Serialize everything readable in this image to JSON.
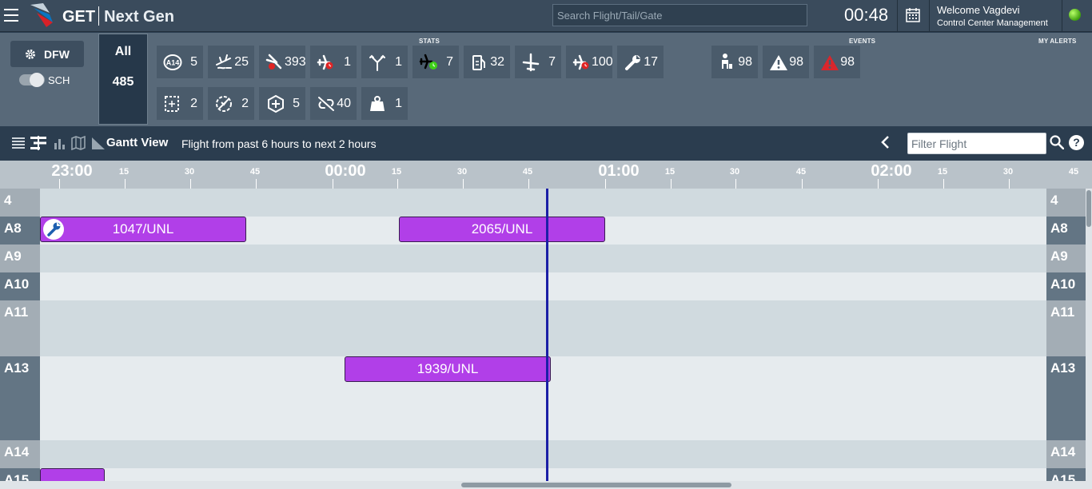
{
  "app": {
    "brand_primary": "GET",
    "brand_secondary": "Next Gen",
    "search_placeholder": "Search Flight/Tail/Gate",
    "clock": "00:48",
    "welcome": "Welcome Vagdevi",
    "role": "Control Center Management",
    "status_color": "#6bd11b"
  },
  "stats_panel": {
    "station": "DFW",
    "station_icon": "gear-icon",
    "toggle_label": "SCH",
    "all_label": "All",
    "all_count": "485",
    "section_stats": "STATS",
    "section_events": "EVENTS",
    "section_alerts": "MY ALERTS",
    "stats_row1": [
      {
        "icon": "a14-gate-badge-icon",
        "badge": "A14",
        "value": "5"
      },
      {
        "icon": "departure-route-icon",
        "value": "25"
      },
      {
        "icon": "delayed-arrival-icon",
        "value": "393"
      },
      {
        "icon": "late-departure-icon",
        "value": "1"
      },
      {
        "icon": "diversion-icon",
        "value": "1"
      },
      {
        "icon": "on-time-flight-icon",
        "value": "7"
      },
      {
        "icon": "fuel-icon",
        "value": "32"
      },
      {
        "icon": "aircraft-icon",
        "value": "7"
      },
      {
        "icon": "flight-delay-icon",
        "value": "100"
      },
      {
        "icon": "wrench-icon",
        "value": "17"
      }
    ],
    "stats_row2": [
      {
        "icon": "gate-hold-icon",
        "value": "2"
      },
      {
        "icon": "no-crew-icon",
        "value": "2"
      },
      {
        "icon": "inspection-icon",
        "value": "5"
      },
      {
        "icon": "broken-link-icon",
        "value": "40"
      },
      {
        "icon": "baggage-weight-icon",
        "value": "1"
      }
    ],
    "events": [
      {
        "icon": "passenger-icon",
        "value": "98"
      },
      {
        "icon": "warning-icon",
        "value": "98"
      },
      {
        "icon": "alert-red-icon",
        "value": "98"
      }
    ]
  },
  "toolbar": {
    "view_label": "Gantt View",
    "range_text": "Flight from past 6 hours to next 2 hours",
    "filter_placeholder": "Filter Flight",
    "help_label": "?"
  },
  "timeline": {
    "major": [
      "23:00",
      "00:00",
      "01:00",
      "02:00"
    ],
    "minor": [
      "15",
      "30",
      "45"
    ]
  },
  "gantt": {
    "rows": [
      {
        "gate": "4"
      },
      {
        "gate": "A8"
      },
      {
        "gate": "A9"
      },
      {
        "gate": "A10"
      },
      {
        "gate": "A11"
      },
      {
        "gate": "A13"
      },
      {
        "gate": "A14"
      },
      {
        "gate": "A15"
      }
    ],
    "flights": [
      {
        "label": "1047/UNL",
        "gate": "A8",
        "start": "22:54",
        "end": "23:39"
      },
      {
        "label": "2065/UNL",
        "gate": "A8",
        "start": "00:12",
        "end": "00:57"
      },
      {
        "label": "1939/UNL",
        "gate": "A13",
        "start": "00:00",
        "end": "00:45"
      },
      {
        "label": "",
        "gate": "A15",
        "start": "22:54",
        "end": "23:08"
      }
    ],
    "current_time": "00:48",
    "bar_color": "#b13fe8",
    "now_color": "#1b1fa6"
  }
}
